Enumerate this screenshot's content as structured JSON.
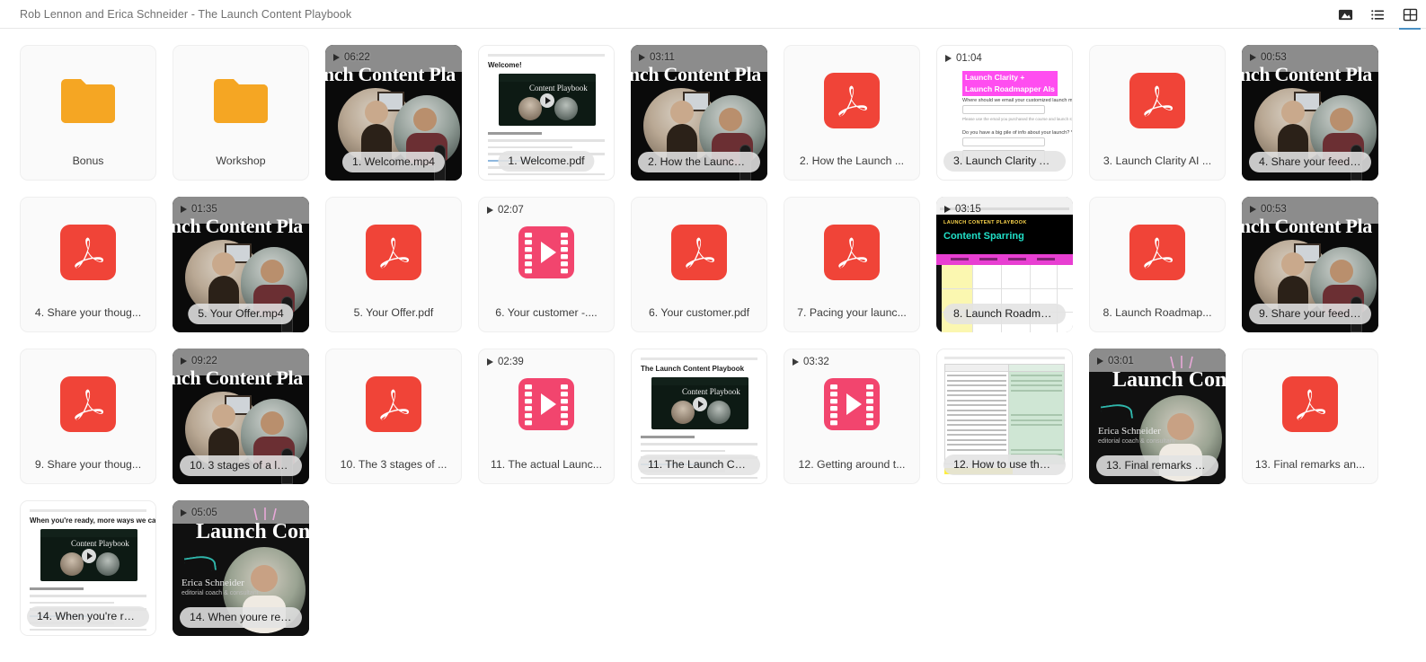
{
  "header": {
    "breadcrumb": "Rob Lennon and Erica Schneider - The Launch Content Playbook",
    "view_toggles": [
      {
        "name": "image-view-icon",
        "label": "Image view",
        "selected": false
      },
      {
        "name": "list-view-icon",
        "label": "List view",
        "selected": false
      },
      {
        "name": "grid-view-icon",
        "label": "Grid view",
        "selected": true
      }
    ]
  },
  "colors": {
    "folder": "#f5a623",
    "pdf": "#f04438",
    "video_file": "#f2456e",
    "accent_selected": "#4a90c4",
    "page_bg": "#ffffff",
    "tile_bg": "#fafafa"
  },
  "items": [
    {
      "kind": "folder",
      "name": "Bonus",
      "duration": null
    },
    {
      "kind": "folder",
      "name": "Workshop",
      "duration": null
    },
    {
      "kind": "webinar",
      "name": "1. Welcome.mp4",
      "duration": "06:22"
    },
    {
      "kind": "doc",
      "name": "1. Welcome.pdf",
      "duration": null,
      "doc_title": "Welcome!",
      "doc_video_title": "Content Playbook"
    },
    {
      "kind": "webinar",
      "name": "2. How the Launch ...",
      "duration": "03:11"
    },
    {
      "kind": "pdf",
      "name": "2. How the Launch ...",
      "duration": null
    },
    {
      "kind": "form",
      "name": "3. Launch Clarity AI ...",
      "duration": "01:04",
      "form_title": "Launch Clarity + Launch Roadmapper AIs",
      "form_q1": "Where should we email your customized launch materials? *",
      "form_note": "Please use the email you purchased the course and launch system with",
      "form_q2": "Do you have a big pile of info about your launch? *"
    },
    {
      "kind": "pdf",
      "name": "3. Launch Clarity AI ...",
      "duration": null
    },
    {
      "kind": "webinar",
      "name": "4. Share your feedb...",
      "duration": "00:53"
    },
    {
      "kind": "pdf",
      "name": "4. Share your thoug...",
      "duration": null
    },
    {
      "kind": "webinar",
      "name": "5. Your Offer.mp4",
      "duration": "01:35"
    },
    {
      "kind": "pdf",
      "name": "5. Your Offer.pdf",
      "duration": null
    },
    {
      "kind": "video",
      "name": "6. Your customer -....",
      "duration": "02:07"
    },
    {
      "kind": "pdf",
      "name": "6. Your customer.pdf",
      "duration": null
    },
    {
      "kind": "pdf",
      "name": "7. Pacing your launc...",
      "duration": null
    },
    {
      "kind": "sheet",
      "name": "8. Launch Roadmap...",
      "duration": "03:15",
      "sheet_kicker": "LAUNCH CONTENT PLAYBOOK",
      "sheet_title": "Content Sparring"
    },
    {
      "kind": "pdf",
      "name": "8. Launch Roadmap...",
      "duration": null
    },
    {
      "kind": "webinar",
      "name": "9. Share your feedb...",
      "duration": "00:53"
    },
    {
      "kind": "pdf",
      "name": "9. Share your thoug...",
      "duration": null
    },
    {
      "kind": "webinar",
      "name": "10. 3 stages of a lau...",
      "duration": "09:22"
    },
    {
      "kind": "pdf",
      "name": "10. The 3 stages of ...",
      "duration": null
    },
    {
      "kind": "video",
      "name": "11. The actual Launc...",
      "duration": "02:39"
    },
    {
      "kind": "doc",
      "name": "11. The Launch Cont...",
      "duration": null,
      "doc_title": "The Launch Content Playbook",
      "doc_video_title": "Content Playbook",
      "doc_sub": "How to use the Playbook"
    },
    {
      "kind": "video",
      "name": "12. Getting around t...",
      "duration": "03:32"
    },
    {
      "kind": "tmpl",
      "name": "12. How to use the ...",
      "duration": null
    },
    {
      "kind": "solo",
      "name": "13. Final remarks an...",
      "duration": "03:01",
      "solo_title": "Launch Cont",
      "solo_name": "Erica Schneider",
      "solo_role": "editorial coach & consultant"
    },
    {
      "kind": "pdf",
      "name": "13. Final remarks an...",
      "duration": null
    },
    {
      "kind": "doc",
      "name": "14. When you're rea...",
      "duration": null,
      "doc_title": "When you're ready, more ways we can help",
      "doc_video_title": "Content Playbook"
    },
    {
      "kind": "solo",
      "name": "14. When youre rea...",
      "duration": "05:05",
      "solo_title": "Launch Cont",
      "solo_name": "Erica Schneider",
      "solo_role": "editorial coach & consultant"
    }
  ]
}
